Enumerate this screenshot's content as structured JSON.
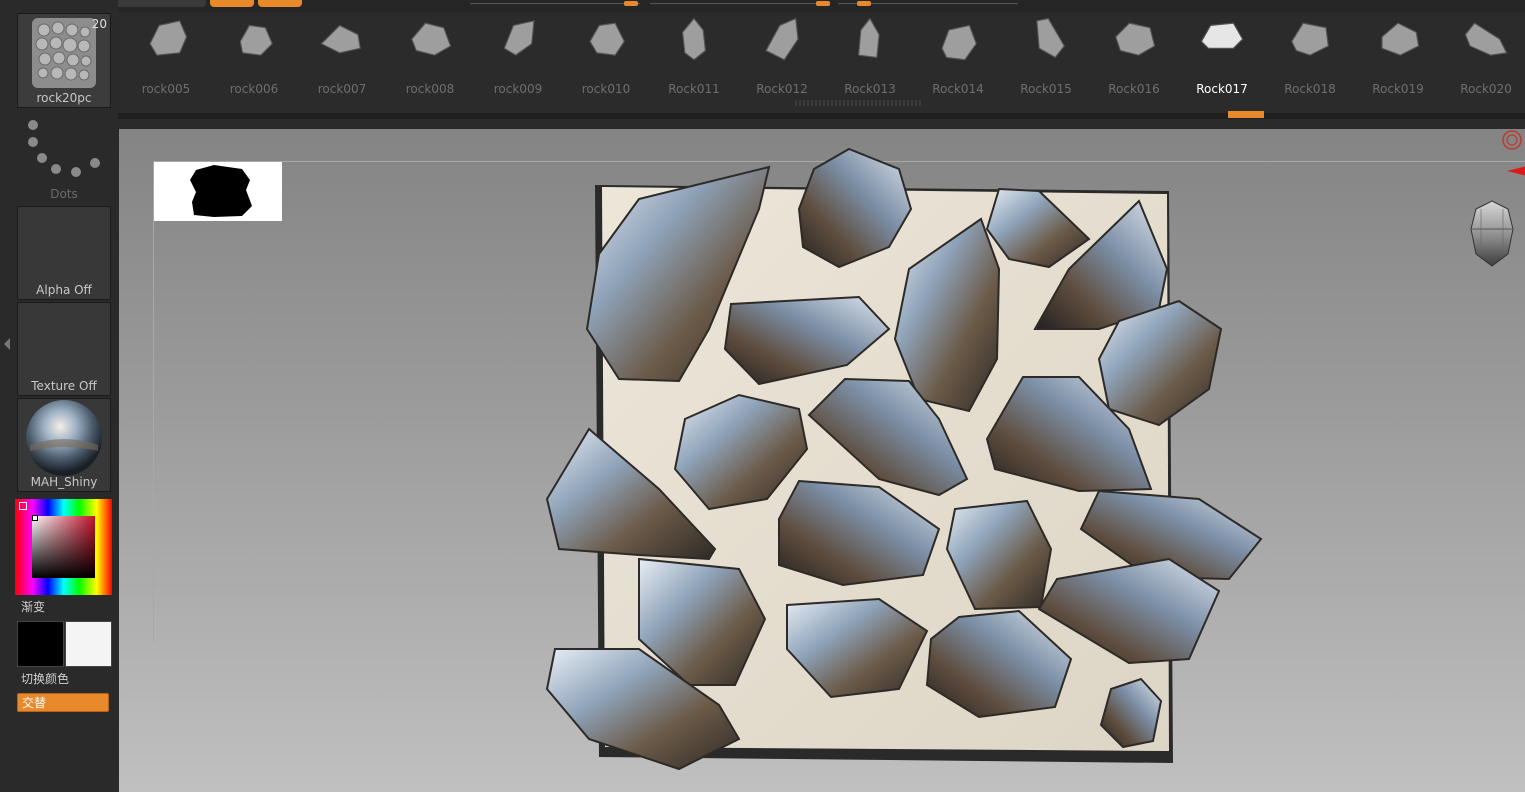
{
  "brush_thumb": {
    "label": "rock20pc",
    "count": "20"
  },
  "stroke_thumb": {
    "label": "Dots"
  },
  "alpha_thumb": {
    "label": "Alpha Off"
  },
  "texture_thumb": {
    "label": "Texture Off"
  },
  "material_thumb": {
    "label": "MAH_Shiny"
  },
  "color": {
    "gradient_label": "渐变",
    "swap_label": "切换颜色",
    "alternate_label": "交替",
    "primary": "#000000",
    "secondary": "#f4f4f4"
  },
  "colors": {
    "accent": "#e8892c",
    "panel": "#2a2a2a",
    "rock_canvas": "#e2dccf"
  },
  "shelf": {
    "items": [
      {
        "label": "rock005"
      },
      {
        "label": "rock006"
      },
      {
        "label": "rock007"
      },
      {
        "label": "rock008"
      },
      {
        "label": "rock009"
      },
      {
        "label": "rock010"
      },
      {
        "label": "Rock011"
      },
      {
        "label": "Rock012"
      },
      {
        "label": "Rock013"
      },
      {
        "label": "Rock014"
      },
      {
        "label": "Rock015"
      },
      {
        "label": "Rock016"
      },
      {
        "label": "Rock017",
        "selected": true
      },
      {
        "label": "Rock018"
      },
      {
        "label": "Rock019"
      },
      {
        "label": "Rock020"
      }
    ]
  },
  "viewport": {
    "navigation_icon": "head-gizmo-icon",
    "alpha_preview_icon": "alpha-shape-icon"
  }
}
